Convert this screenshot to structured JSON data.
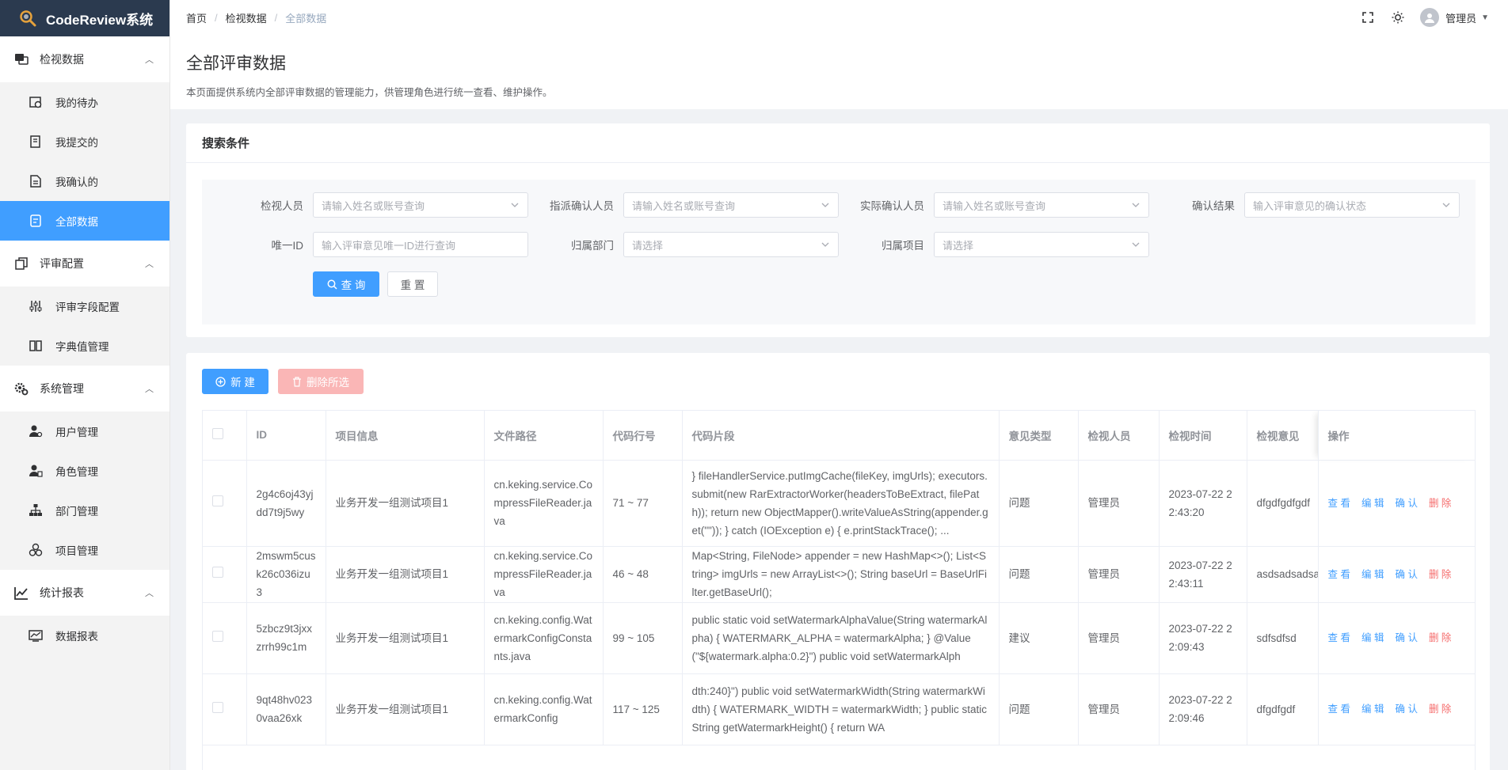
{
  "app": {
    "title": "CodeReview系统"
  },
  "sidebar": {
    "groups": [
      {
        "label": "检视数据",
        "items": [
          {
            "label": "我的待办"
          },
          {
            "label": "我提交的"
          },
          {
            "label": "我确认的"
          },
          {
            "label": "全部数据"
          }
        ]
      },
      {
        "label": "评审配置",
        "items": [
          {
            "label": "评审字段配置"
          },
          {
            "label": "字典值管理"
          }
        ]
      },
      {
        "label": "系统管理",
        "items": [
          {
            "label": "用户管理"
          },
          {
            "label": "角色管理"
          },
          {
            "label": "部门管理"
          },
          {
            "label": "项目管理"
          }
        ]
      },
      {
        "label": "统计报表",
        "items": [
          {
            "label": "数据报表"
          }
        ]
      }
    ]
  },
  "breadcrumb": {
    "home": "首页",
    "parent": "检视数据",
    "current": "全部数据"
  },
  "user": {
    "name": "管理员"
  },
  "page": {
    "title": "全部评审数据",
    "description": "本页面提供系统内全部评审数据的管理能力，供管理角色进行统一查看、维护操作。"
  },
  "search": {
    "title": "搜索条件",
    "reviewer_label": "检视人员",
    "reviewer_placeholder": "请输入姓名或账号查询",
    "assigned_label": "指派确认人员",
    "assigned_placeholder": "请输入姓名或账号查询",
    "actual_label": "实际确认人员",
    "actual_placeholder": "请输入姓名或账号查询",
    "result_label": "确认结果",
    "result_placeholder": "输入评审意见的确认状态",
    "uid_label": "唯一ID",
    "uid_placeholder": "输入评审意见唯一ID进行查询",
    "dept_label": "归属部门",
    "dept_placeholder": "请选择",
    "project_label": "归属项目",
    "project_placeholder": "请选择",
    "query_button": "查 询",
    "reset_button": "重 置"
  },
  "toolbar": {
    "new_button": "新 建",
    "delete_button": "删除所选"
  },
  "table": {
    "headers": {
      "id": "ID",
      "project": "项目信息",
      "file": "文件路径",
      "line": "代码行号",
      "snippet": "代码片段",
      "type": "意见类型",
      "reviewer": "检视人员",
      "time": "检视时间",
      "opinion": "检视意见",
      "ops": "操作"
    },
    "actions": {
      "view": "查 看",
      "edit": "编 辑",
      "confirm": "确 认",
      "delete": "删 除"
    },
    "rows": [
      {
        "id": "2g4c6oj43yjdd7t9j5wy",
        "project": "业务开发一组测试项目1",
        "file": "cn.keking.service.CompressFileReader.java",
        "line": "71 ~ 77",
        "snippet": "} fileHandlerService.putImgCache(fileKey, imgUrls); executors.submit(new RarExtractorWorker(headersToBeExtract, filePath)); return new ObjectMapper().writeValueAsString(appender.get(\"\")); } catch (IOException e) { e.printStackTrace(); ...",
        "type": "问题",
        "reviewer": "管理员",
        "time": "2023-07-22 22:43:20",
        "opinion": "dfgdfgdfgdf"
      },
      {
        "id": "2mswm5cusk26c036izu3",
        "project": "业务开发一组测试项目1",
        "file": "cn.keking.service.CompressFileReader.java",
        "line": "46 ~ 48",
        "snippet": "Map<String, FileNode> appender = new HashMap<>(); List<String> imgUrls = new ArrayList<>(); String baseUrl = BaseUrlFilter.getBaseUrl();",
        "type": "问题",
        "reviewer": "管理员",
        "time": "2023-07-22 22:43:11",
        "opinion": "asdsadsadsad"
      },
      {
        "id": "5zbcz9t3jxxzrrh99c1m",
        "project": "业务开发一组测试项目1",
        "file": "cn.keking.config.WatermarkConfigConstants.java",
        "line": "99 ~ 105",
        "snippet": "public static void setWatermarkAlphaValue(String watermarkAlpha) { WATERMARK_ALPHA = watermarkAlpha; } @Value(\"${watermark.alpha:0.2}\") public void setWatermarkAlph",
        "type": "建议",
        "reviewer": "管理员",
        "time": "2023-07-22 22:09:43",
        "opinion": "sdfsdfsd"
      },
      {
        "id": "9qt48hv0230vaa26xk",
        "project": "业务开发一组测试项目1",
        "file": "cn.keking.config.WatermarkConfig",
        "line": "117 ~ 125",
        "snippet": "dth:240}\") public void setWatermarkWidth(String watermarkWidth) { WATERMARK_WIDTH = watermarkWidth; } public static String getWatermarkHeight() { return WA",
        "type": "问题",
        "reviewer": "管理员",
        "time": "2023-07-22 22:09:46",
        "opinion": "dfgdfgdf"
      }
    ]
  }
}
